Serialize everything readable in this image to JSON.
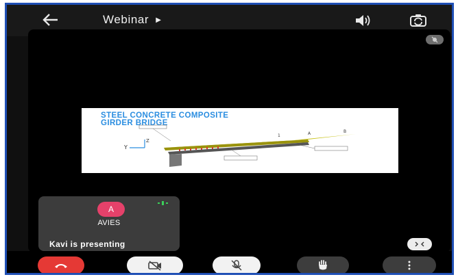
{
  "header": {
    "title": "Webinar",
    "back_icon": "arrow-left-icon",
    "speaker_icon": "speaker-icon",
    "camera_switch_icon": "camera-switch-icon"
  },
  "slide": {
    "title_line1": "STEEL CONCRETE COMPOSITE",
    "title_line2": "GIRDER BRIDGE",
    "title_color": "#2a8de0"
  },
  "participant": {
    "avatar_letter": "A",
    "name": "AVIES",
    "avatar_color": "#e5416a"
  },
  "status": {
    "presenting": "Kavi is presenting"
  },
  "controls": {
    "end_call_color": "#e53935",
    "items": [
      "end-call",
      "camera-off",
      "mic-off",
      "raise-hand",
      "more-options"
    ]
  }
}
